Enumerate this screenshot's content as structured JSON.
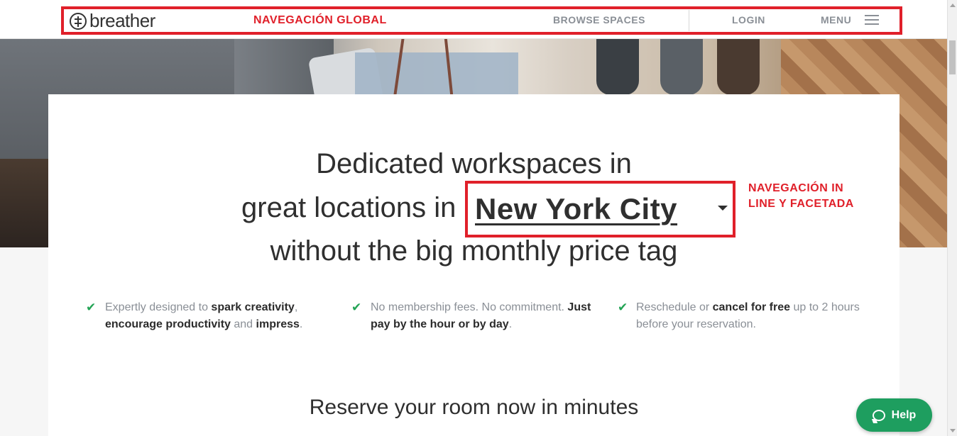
{
  "header": {
    "logo_text": "breather",
    "nav": {
      "browse": "BROWSE SPACES",
      "login": "LOGIN",
      "menu": "MENU"
    }
  },
  "annotations": {
    "global_nav": "NAVEGACIÓN GLOBAL",
    "inline_nav_line1": "NAVEGACIÓN IN",
    "inline_nav_line2": "LINE Y FACETADA",
    "color": "#e0202a"
  },
  "hero": {
    "line1": "Dedicated workspaces in",
    "line2_prefix": "great locations in",
    "city": "New York City",
    "line3": "without the big monthly price tag"
  },
  "features": [
    {
      "parts": [
        "Expertly designed to ",
        "spark creativity",
        ", ",
        "encourage productivity",
        " and ",
        "impress",
        "."
      ]
    },
    {
      "parts": [
        "No membership fees. No commitment. ",
        "Just pay by the hour or by day",
        "."
      ]
    },
    {
      "parts": [
        "Reschedule or ",
        "cancel for free",
        " up to 2 hours before your reservation."
      ]
    }
  ],
  "reserve_heading": "Reserve your room now in minutes",
  "help": {
    "label": "Help",
    "color": "#1e9e5f"
  },
  "colors": {
    "check": "#23a455",
    "muted_text": "#8a8f96",
    "dark_text": "#2f2f2f"
  }
}
